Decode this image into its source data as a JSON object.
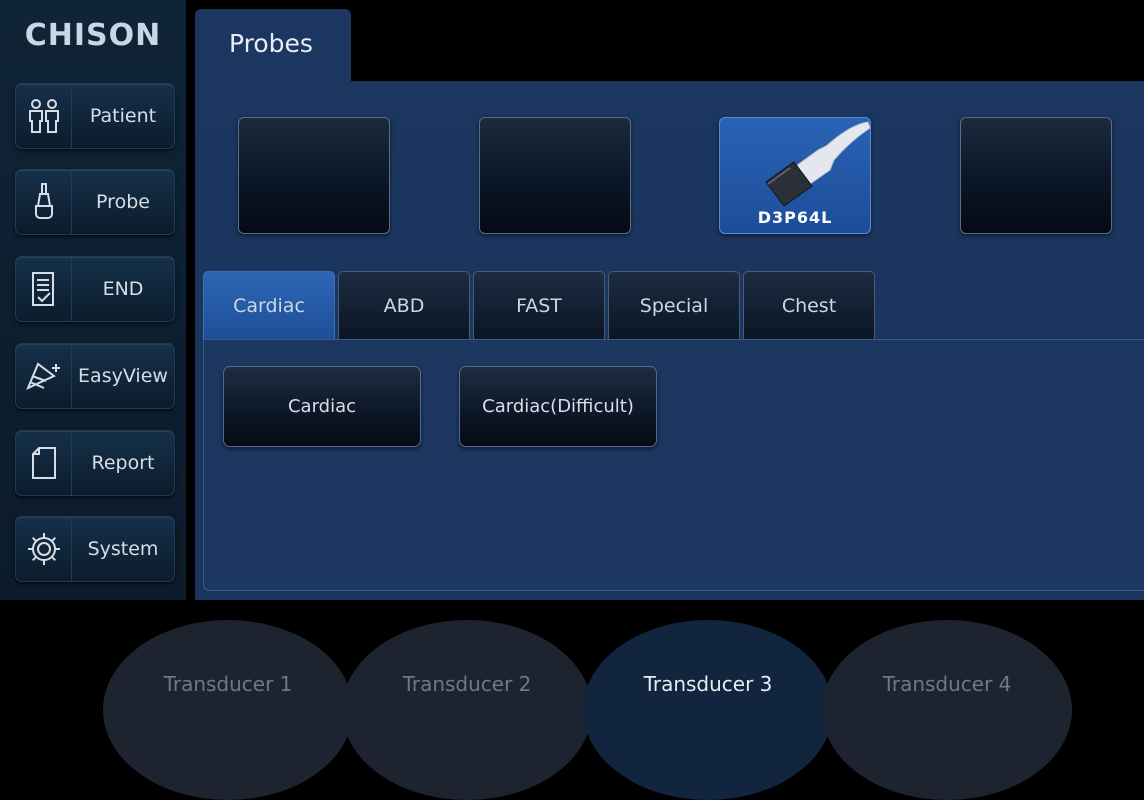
{
  "sidebar": {
    "logo": "CHISON",
    "items": [
      {
        "label": "Patient",
        "icon": "patient-icon"
      },
      {
        "label": "Probe",
        "icon": "probe-icon"
      },
      {
        "label": "END",
        "icon": "end-exam-icon"
      },
      {
        "label": "EasyView",
        "icon": "easyview-icon"
      },
      {
        "label": "Report",
        "icon": "report-icon"
      },
      {
        "label": "System",
        "icon": "system-gear-icon"
      }
    ]
  },
  "header": {
    "tab_label": "Probes"
  },
  "probes": {
    "slots": [
      {
        "name": "",
        "active": false
      },
      {
        "name": "",
        "active": false
      },
      {
        "name": "D3P64L",
        "active": true,
        "icon": "linear-probe-icon"
      },
      {
        "name": "",
        "active": false
      }
    ]
  },
  "exam_tabs": {
    "items": [
      "Cardiac",
      "ABD",
      "FAST",
      "Special",
      "Chest"
    ],
    "selected": "Cardiac"
  },
  "presets": {
    "items": [
      "Cardiac",
      "Cardiac(Difficult)"
    ]
  },
  "transducers": {
    "items": [
      "Transducer 1",
      "Transducer 2",
      "Transducer 3",
      "Transducer 4"
    ],
    "selected": "Transducer 3"
  },
  "colors": {
    "accent": "#2a63b4",
    "panel": "#1b365f",
    "sidebar": "#0f2436"
  }
}
